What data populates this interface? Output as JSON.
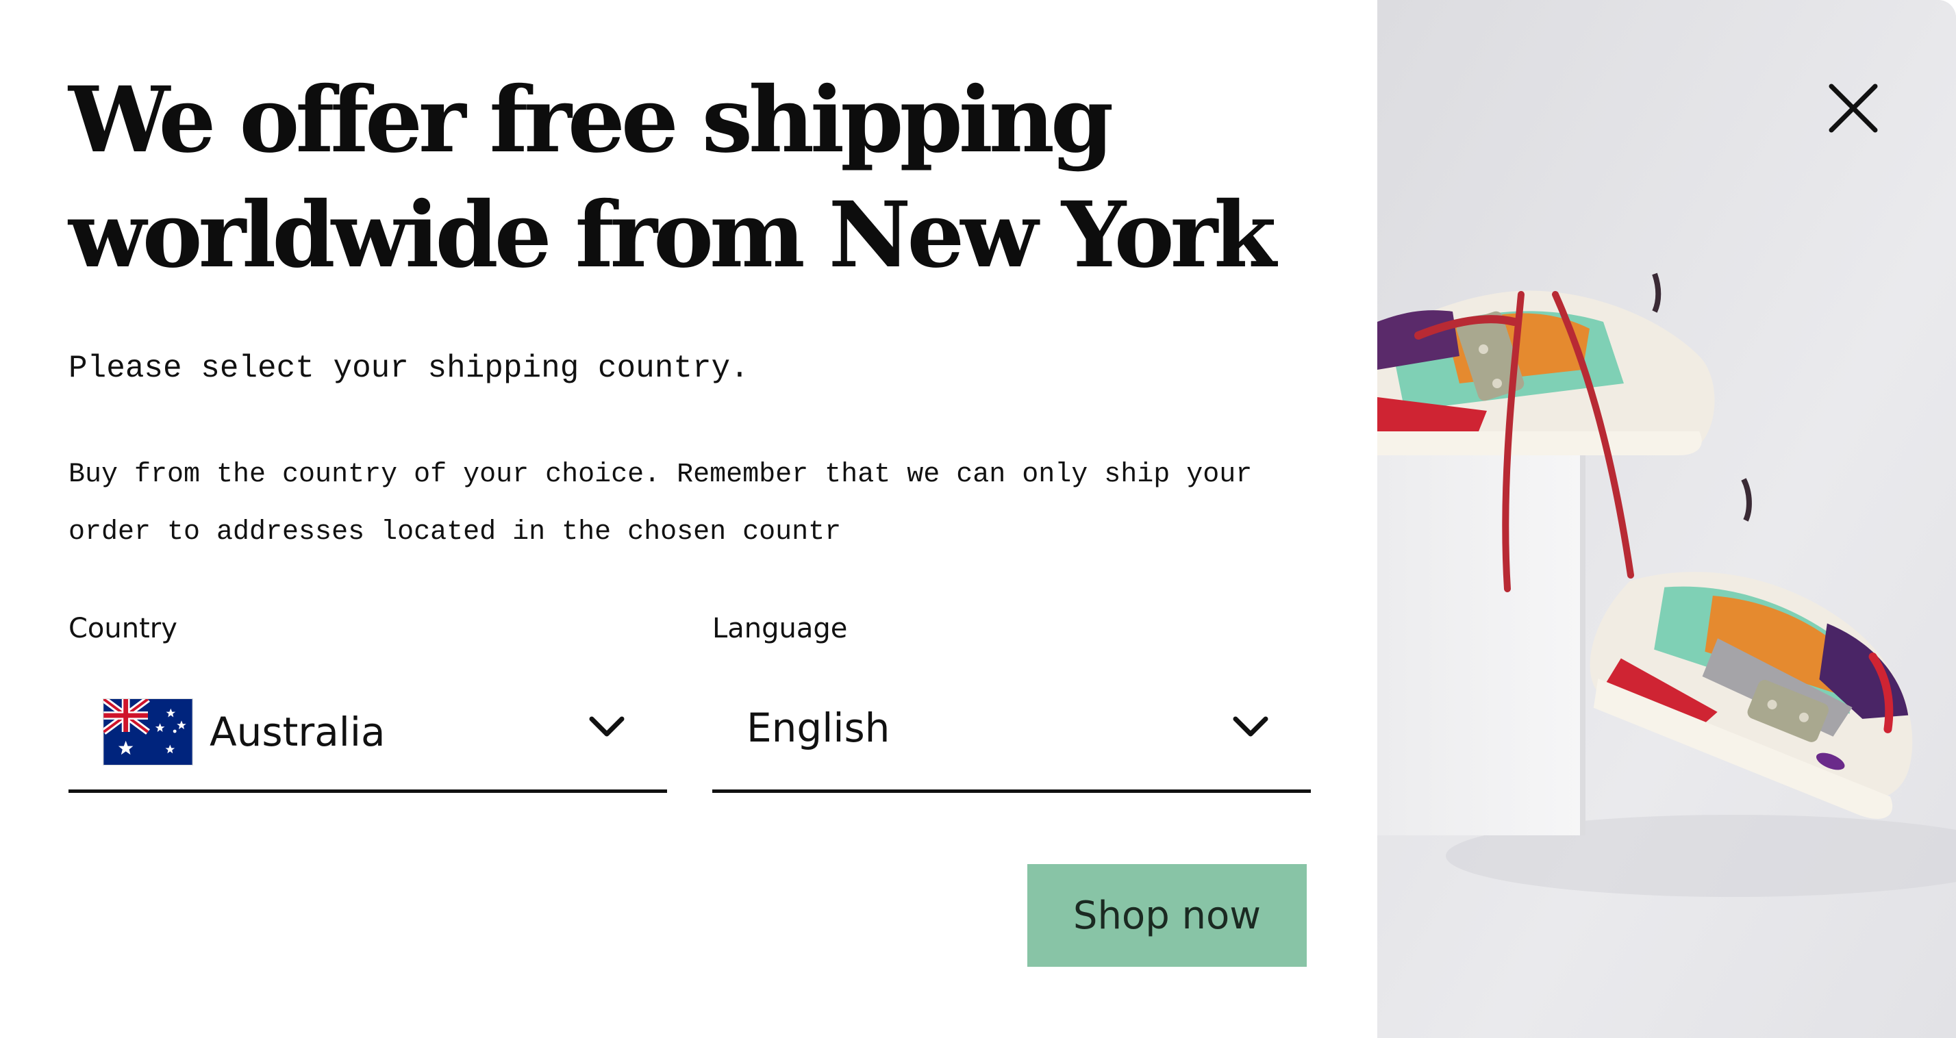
{
  "modal": {
    "headline": {
      "line1": "We offer free shipping",
      "line2": "worldwide from New York"
    },
    "prompt": "Please select your shipping country.",
    "description": {
      "line1": "Buy from the country of your choice. Remember that we can only ship your",
      "line2": "order to addresses located in the chosen countr"
    },
    "country": {
      "label": "Country",
      "value": "Australia",
      "flag_icon": "australia-flag-icon"
    },
    "language": {
      "label": "Language",
      "value": "English"
    },
    "shop_button": "Shop now",
    "close_icon": "close-icon",
    "colors": {
      "button": "#88c4a6",
      "text": "#111111",
      "image_bg": "#e5e5e8"
    }
  }
}
